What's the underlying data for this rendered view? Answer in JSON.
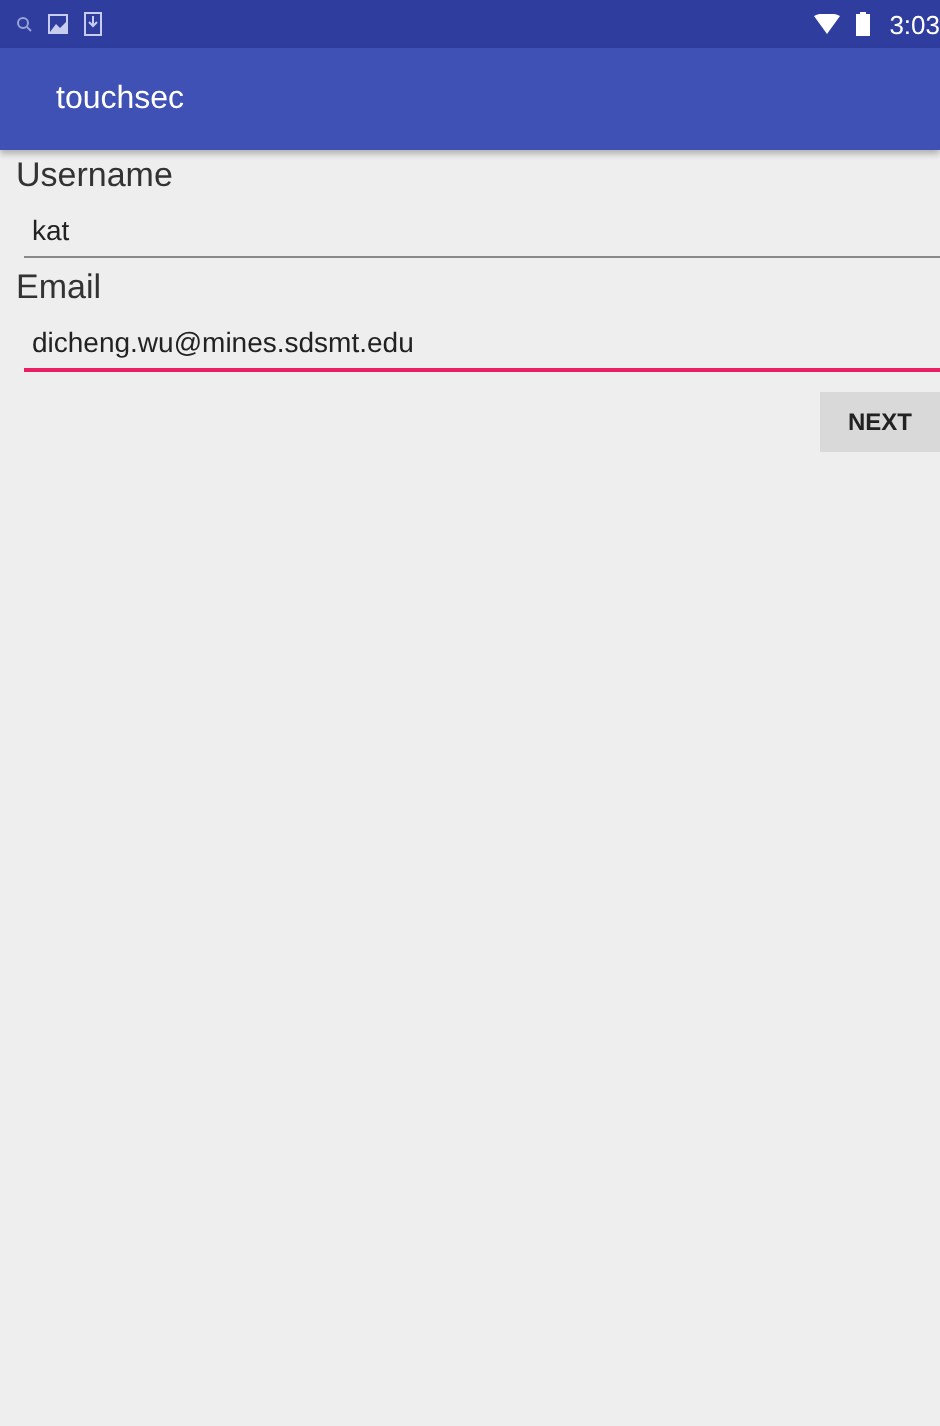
{
  "status_bar": {
    "time": "3:03"
  },
  "app_bar": {
    "title": "touchsec"
  },
  "fields": [
    {
      "label": "Username",
      "value": "kat",
      "focused": false
    },
    {
      "label": "Email",
      "value": "dicheng.wu@mines.sdsmt.edu",
      "focused": true
    }
  ],
  "buttons": [
    "NEXT"
  ]
}
